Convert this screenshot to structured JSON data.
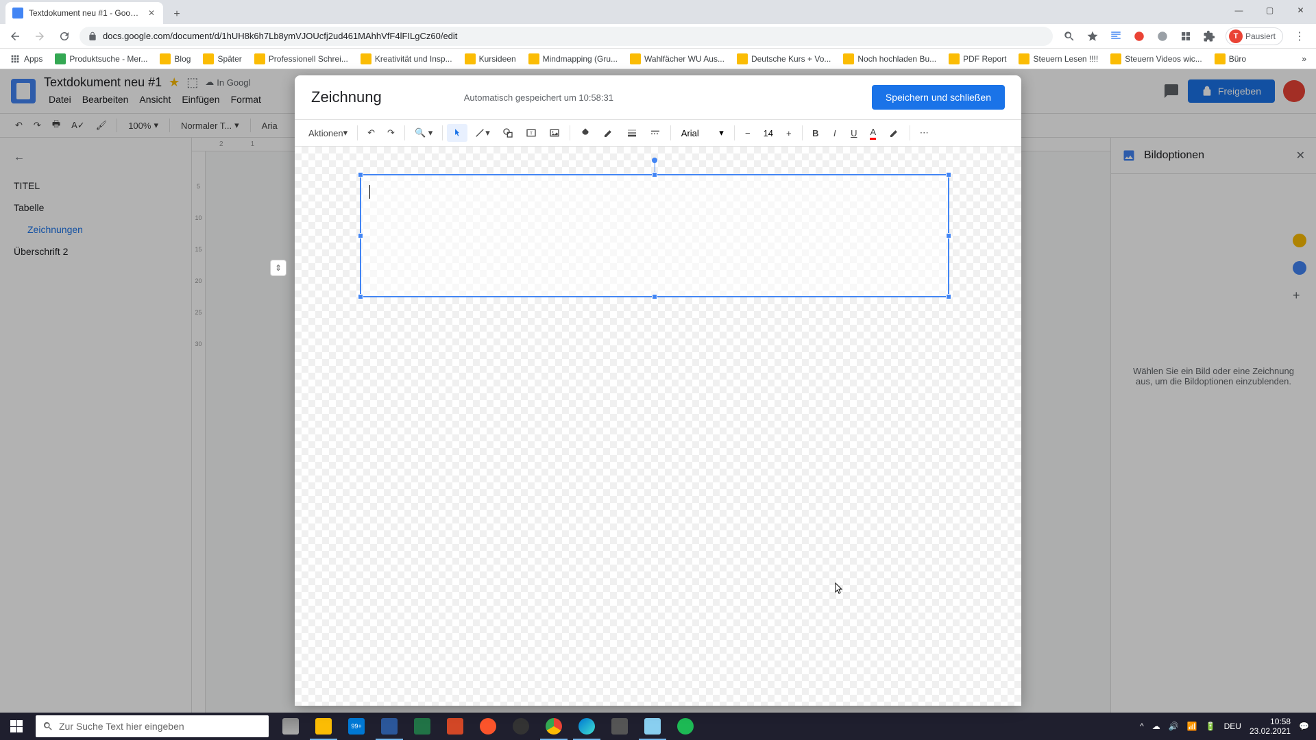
{
  "browser": {
    "tab_title": "Textdokument neu #1 - Google D",
    "url": "docs.google.com/document/d/1hUH8k6h7Lb8ymVJOUcfj2ud461MAhhVfF4lFILgCz60/edit",
    "paused_label": "Pausiert",
    "window": {
      "min": "—",
      "max": "▢",
      "close": "✕"
    }
  },
  "bookmarks": {
    "apps": "Apps",
    "items": [
      "Produktsuche - Mer...",
      "Blog",
      "Später",
      "Professionell Schrei...",
      "Kreativität und Insp...",
      "Kursideen",
      "Mindmapping  (Gru...",
      "Wahlfächer WU Aus...",
      "Deutsche Kurs + Vo...",
      "Noch hochladen Bu...",
      "PDF Report",
      "Steuern Lesen !!!!",
      "Steuern Videos wic...",
      "Büro"
    ]
  },
  "docs": {
    "title": "Textdokument neu #1",
    "cloud_status": "In Googl",
    "menus": [
      "Datei",
      "Bearbeiten",
      "Ansicht",
      "Einfügen",
      "Format"
    ],
    "share_label": "Freigeben",
    "toolbar": {
      "zoom": "100%",
      "style": "Normaler T...",
      "font": "Aria"
    },
    "outline": {
      "items": [
        {
          "label": "TITEL",
          "indent": false
        },
        {
          "label": "Tabelle",
          "indent": false
        },
        {
          "label": "Zeichnungen",
          "indent": true
        },
        {
          "label": "Überschrift 2",
          "indent": false
        }
      ]
    },
    "ruler_h": [
      "2",
      "1"
    ],
    "ruler_v": [
      "",
      "5",
      "10",
      "15",
      "20",
      "25",
      "30"
    ],
    "image_panel": {
      "title": "Bildoptionen",
      "empty_text": "Wählen Sie ein Bild oder eine Zeichnung aus, um die Bildoptionen einzublenden."
    }
  },
  "drawing": {
    "title": "Zeichnung",
    "status": "Automatisch gespeichert um 10:58:31",
    "save_label": "Speichern und schließen",
    "actions_label": "Aktionen",
    "font": "Arial",
    "font_size": "14"
  },
  "taskbar": {
    "search_placeholder": "Zur Suche Text hier eingeben",
    "lang": "DEU",
    "time": "10:58",
    "date": "23.02.2021",
    "badge": "99+"
  }
}
